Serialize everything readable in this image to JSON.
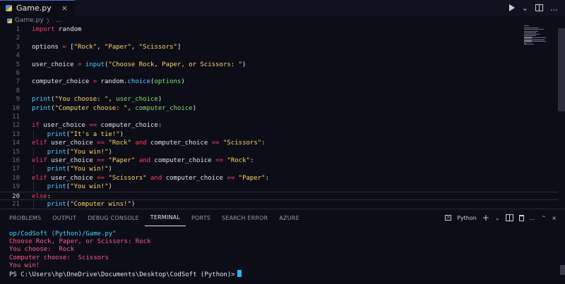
{
  "tab": {
    "filename": "Game.py",
    "close": "×"
  },
  "tab_actions": {
    "dropdown": "⌄",
    "more": "…"
  },
  "breadcrumb": {
    "file": "Game.py",
    "sep": "〉",
    "rest": "..."
  },
  "code": [
    {
      "n": "1",
      "spans": [
        [
          "kw",
          "import"
        ],
        [
          "txt",
          " random"
        ]
      ]
    },
    {
      "n": "2",
      "spans": []
    },
    {
      "n": "3",
      "spans": [
        [
          "txt",
          "options "
        ],
        [
          "op",
          "="
        ],
        [
          "txt",
          " ["
        ],
        [
          "str",
          "\"Rock\""
        ],
        [
          "txt",
          ", "
        ],
        [
          "str",
          "\"Paper\""
        ],
        [
          "txt",
          ", "
        ],
        [
          "str",
          "\"Scissors\""
        ],
        [
          "txt",
          "]"
        ]
      ]
    },
    {
      "n": "4",
      "spans": []
    },
    {
      "n": "5",
      "spans": [
        [
          "txt",
          "user_choice "
        ],
        [
          "op",
          "="
        ],
        [
          "txt",
          " "
        ],
        [
          "fn",
          "input"
        ],
        [
          "txt",
          "("
        ],
        [
          "str",
          "\"Choose Rock, Paper, or Scissors: \""
        ],
        [
          "txt",
          ")"
        ]
      ]
    },
    {
      "n": "6",
      "spans": []
    },
    {
      "n": "7",
      "spans": [
        [
          "txt",
          "computer_choice "
        ],
        [
          "op",
          "="
        ],
        [
          "txt",
          " random."
        ],
        [
          "fn",
          "choice"
        ],
        [
          "txt",
          "("
        ],
        [
          "arg",
          "options"
        ],
        [
          "txt",
          ")"
        ]
      ]
    },
    {
      "n": "8",
      "spans": []
    },
    {
      "n": "9",
      "spans": [
        [
          "fn",
          "print"
        ],
        [
          "txt",
          "("
        ],
        [
          "str",
          "\"You choose: \""
        ],
        [
          "txt",
          ", "
        ],
        [
          "arg",
          "user_choice"
        ],
        [
          "txt",
          ")"
        ]
      ]
    },
    {
      "n": "10",
      "spans": [
        [
          "fn",
          "print"
        ],
        [
          "txt",
          "("
        ],
        [
          "str",
          "\"Computer choose: \""
        ],
        [
          "txt",
          ", "
        ],
        [
          "arg",
          "computer_choice"
        ],
        [
          "txt",
          ")"
        ]
      ]
    },
    {
      "n": "11",
      "spans": []
    },
    {
      "n": "12",
      "spans": [
        [
          "kw",
          "if"
        ],
        [
          "txt",
          " user_choice "
        ],
        [
          "op",
          "=="
        ],
        [
          "txt",
          " computer_choice:"
        ]
      ]
    },
    {
      "n": "13",
      "spans": [
        [
          "txt",
          "    "
        ],
        [
          "fn",
          "print"
        ],
        [
          "txt",
          "("
        ],
        [
          "str",
          "\"It's a tie!\""
        ],
        [
          "txt",
          ")"
        ]
      ]
    },
    {
      "n": "14",
      "spans": [
        [
          "kw",
          "elif"
        ],
        [
          "txt",
          " user_choice "
        ],
        [
          "op",
          "=="
        ],
        [
          "txt",
          " "
        ],
        [
          "str",
          "\"Rock\""
        ],
        [
          "txt",
          " "
        ],
        [
          "kw",
          "and"
        ],
        [
          "txt",
          " computer_choice "
        ],
        [
          "op",
          "=="
        ],
        [
          "txt",
          " "
        ],
        [
          "str",
          "\"Scissors\""
        ],
        [
          "txt",
          ":"
        ]
      ]
    },
    {
      "n": "15",
      "spans": [
        [
          "txt",
          "    "
        ],
        [
          "fn",
          "print"
        ],
        [
          "txt",
          "("
        ],
        [
          "str",
          "\"You win!\""
        ],
        [
          "txt",
          ")"
        ]
      ]
    },
    {
      "n": "16",
      "spans": [
        [
          "kw",
          "elif"
        ],
        [
          "txt",
          " user_choice "
        ],
        [
          "op",
          "=="
        ],
        [
          "txt",
          " "
        ],
        [
          "str",
          "\"Paper\""
        ],
        [
          "txt",
          " "
        ],
        [
          "kw",
          "and"
        ],
        [
          "txt",
          " computer_choice "
        ],
        [
          "op",
          "=="
        ],
        [
          "txt",
          " "
        ],
        [
          "str",
          "\"Rock\""
        ],
        [
          "txt",
          ":"
        ]
      ]
    },
    {
      "n": "17",
      "spans": [
        [
          "txt",
          "    "
        ],
        [
          "fn",
          "print"
        ],
        [
          "txt",
          "("
        ],
        [
          "str",
          "\"You win!\""
        ],
        [
          "txt",
          ")"
        ]
      ]
    },
    {
      "n": "18",
      "spans": [
        [
          "kw",
          "elif"
        ],
        [
          "txt",
          " user_choice "
        ],
        [
          "op",
          "=="
        ],
        [
          "txt",
          " "
        ],
        [
          "str",
          "\"Scissors\""
        ],
        [
          "txt",
          " "
        ],
        [
          "kw",
          "and"
        ],
        [
          "txt",
          " computer_choice "
        ],
        [
          "op",
          "=="
        ],
        [
          "txt",
          " "
        ],
        [
          "str",
          "\"Paper\""
        ],
        [
          "txt",
          ":"
        ]
      ]
    },
    {
      "n": "19",
      "spans": [
        [
          "txt",
          "    "
        ],
        [
          "fn",
          "print"
        ],
        [
          "txt",
          "("
        ],
        [
          "str",
          "\"You win!\""
        ],
        [
          "txt",
          ")"
        ]
      ]
    },
    {
      "n": "20",
      "spans": [
        [
          "kw",
          "else"
        ],
        [
          "txt",
          ":"
        ]
      ],
      "active": true
    },
    {
      "n": "21",
      "spans": [
        [
          "txt",
          "    "
        ],
        [
          "fn",
          "print"
        ],
        [
          "txt",
          "("
        ],
        [
          "str",
          "\"Computer wins!\""
        ],
        [
          "txt",
          ")"
        ]
      ]
    }
  ],
  "panel": {
    "tabs": [
      "PROBLEMS",
      "OUTPUT",
      "DEBUG CONSOLE",
      "TERMINAL",
      "PORTS",
      "SEARCH ERROR",
      "AZURE"
    ],
    "active_tab": "TERMINAL",
    "profile": "Python",
    "plus": "+",
    "chevron": "⌄",
    "more": "…",
    "collapse": "⌃",
    "close": "×"
  },
  "terminal": {
    "lines": [
      {
        "kind": "cmd",
        "text": "op/CodSoft (Python)/Game.py\""
      },
      {
        "kind": "out",
        "text": "Choose Rock, Paper, or Scissors: Rock"
      },
      {
        "kind": "out",
        "text": "You choose:  Rock"
      },
      {
        "kind": "out",
        "text": "Computer choose:  Scissors"
      },
      {
        "kind": "out",
        "text": "You win!"
      }
    ],
    "prompt": "PS C:\\Users\\hp\\OneDrive\\Documents\\Desktop\\CodSoft (Python)>"
  },
  "colors": {
    "keyword": "#ff3d6e",
    "string": "#ffd866",
    "function": "#4cd3ff",
    "argument": "#7ee26b",
    "cursor": "#22b8ff"
  }
}
